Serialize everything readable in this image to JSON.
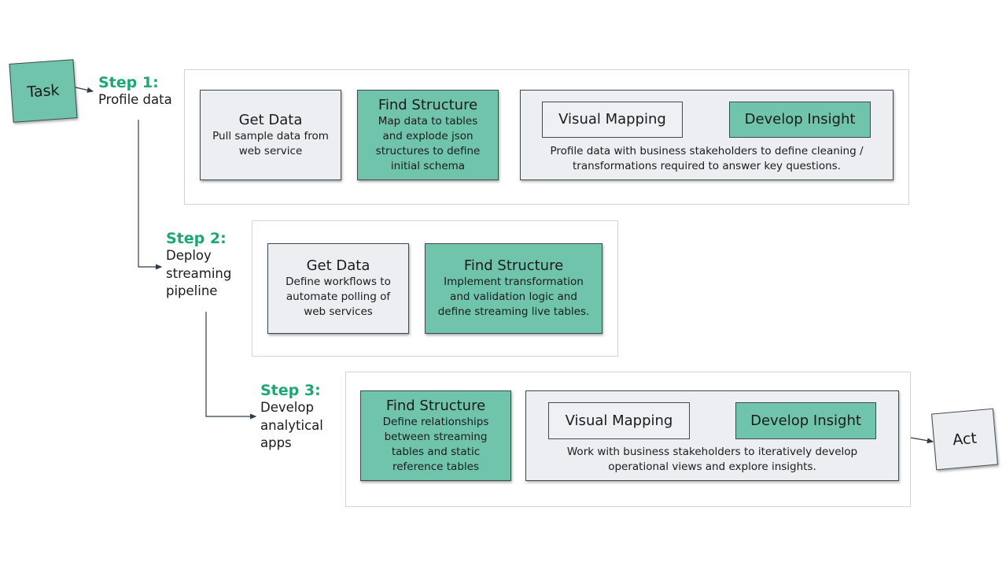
{
  "start_node": {
    "label": "Task",
    "color": "#6fc4ab"
  },
  "end_node": {
    "label": "Act",
    "color": "#eceef2"
  },
  "colors": {
    "accent": "#1aa874",
    "green_box": "#6fc4ab",
    "grey_box": "#eceef2",
    "connector": "#2f3e46"
  },
  "steps": [
    {
      "heading": "Step 1:",
      "subtitle_lines": [
        "Profile data"
      ],
      "cards": [
        {
          "title": "Get Data",
          "lines": [
            "Pull sample data from",
            "web service"
          ]
        },
        {
          "title": "Find Structure",
          "lines": [
            "Map data to tables",
            "and explode json",
            "structures to define",
            "initial schema"
          ]
        }
      ],
      "loop": {
        "left": "Visual Mapping",
        "right": "Develop Insight",
        "caption_lines": [
          "Profile data with business stakeholders to define cleaning /",
          "transformations required to answer key questions."
        ]
      }
    },
    {
      "heading": "Step 2:",
      "subtitle_lines": [
        "Deploy",
        "streaming",
        "pipeline"
      ],
      "cards": [
        {
          "title": "Get Data",
          "lines": [
            "Define workflows to",
            "automate polling of",
            "web services"
          ]
        },
        {
          "title": "Find Structure",
          "lines": [
            "Implement transformation",
            "and validation logic and",
            "define streaming live tables."
          ]
        }
      ]
    },
    {
      "heading": "Step 3:",
      "subtitle_lines": [
        "Develop",
        "analytical",
        "apps"
      ],
      "cards": [
        {
          "title": "Find Structure",
          "lines": [
            "Define relationships",
            "between streaming",
            "tables and static",
            "reference tables"
          ]
        }
      ],
      "loop": {
        "left": "Visual Mapping",
        "right": "Develop Insight",
        "caption_lines": [
          "Work with business stakeholders to iteratively develop",
          "operational views and explore insights."
        ]
      }
    }
  ]
}
